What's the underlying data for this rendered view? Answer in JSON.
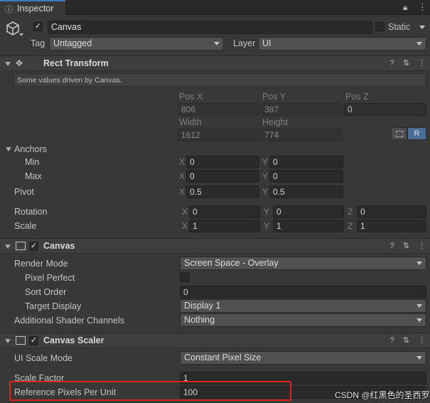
{
  "tab": {
    "title": "Inspector"
  },
  "object": {
    "name": "Canvas",
    "static_label": "Static",
    "tag_label": "Tag",
    "tag_value": "Untagged",
    "layer_label": "Layer",
    "layer_value": "UI"
  },
  "rect_transform": {
    "title": "Rect Transform",
    "note": "Some values driven by Canvas.",
    "pos_x_label": "Pos X",
    "pos_y_label": "Pos Y",
    "pos_z_label": "Pos Z",
    "pos_x": "806",
    "pos_y": "387",
    "pos_z": "0",
    "width_label": "Width",
    "height_label": "Height",
    "width": "1612",
    "height": "774",
    "r_button": "R",
    "anchors_label": "Anchors",
    "min_label": "Min",
    "max_label": "Max",
    "min_x": "0",
    "min_y": "0",
    "max_x": "0",
    "max_y": "0",
    "pivot_label": "Pivot",
    "pivot_x": "0.5",
    "pivot_y": "0.5",
    "rotation_label": "Rotation",
    "rot_x": "0",
    "rot_y": "0",
    "rot_z": "0",
    "scale_label": "Scale",
    "scale_x": "1",
    "scale_y": "1",
    "scale_z": "1",
    "axis_x": "X",
    "axis_y": "Y",
    "axis_z": "Z"
  },
  "canvas": {
    "title": "Canvas",
    "render_mode_label": "Render Mode",
    "render_mode": "Screen Space - Overlay",
    "pixel_perfect_label": "Pixel Perfect",
    "sort_order_label": "Sort Order",
    "sort_order": "0",
    "target_display_label": "Target Display",
    "target_display": "Display 1",
    "shader_channels_label": "Additional Shader Channels",
    "shader_channels": "Nothing"
  },
  "canvas_scaler": {
    "title": "Canvas Scaler",
    "ui_scale_mode_label": "UI Scale Mode",
    "ui_scale_mode": "Constant Pixel Size",
    "scale_factor_label": "Scale Factor",
    "scale_factor": "1",
    "ref_ppu_label": "Reference Pixels Per Unit",
    "ref_ppu": "100"
  },
  "watermark": "CSDN @红黑色的圣西罗",
  "colors": {
    "highlight": "#e0241b",
    "r_button": "#4a6d96"
  }
}
